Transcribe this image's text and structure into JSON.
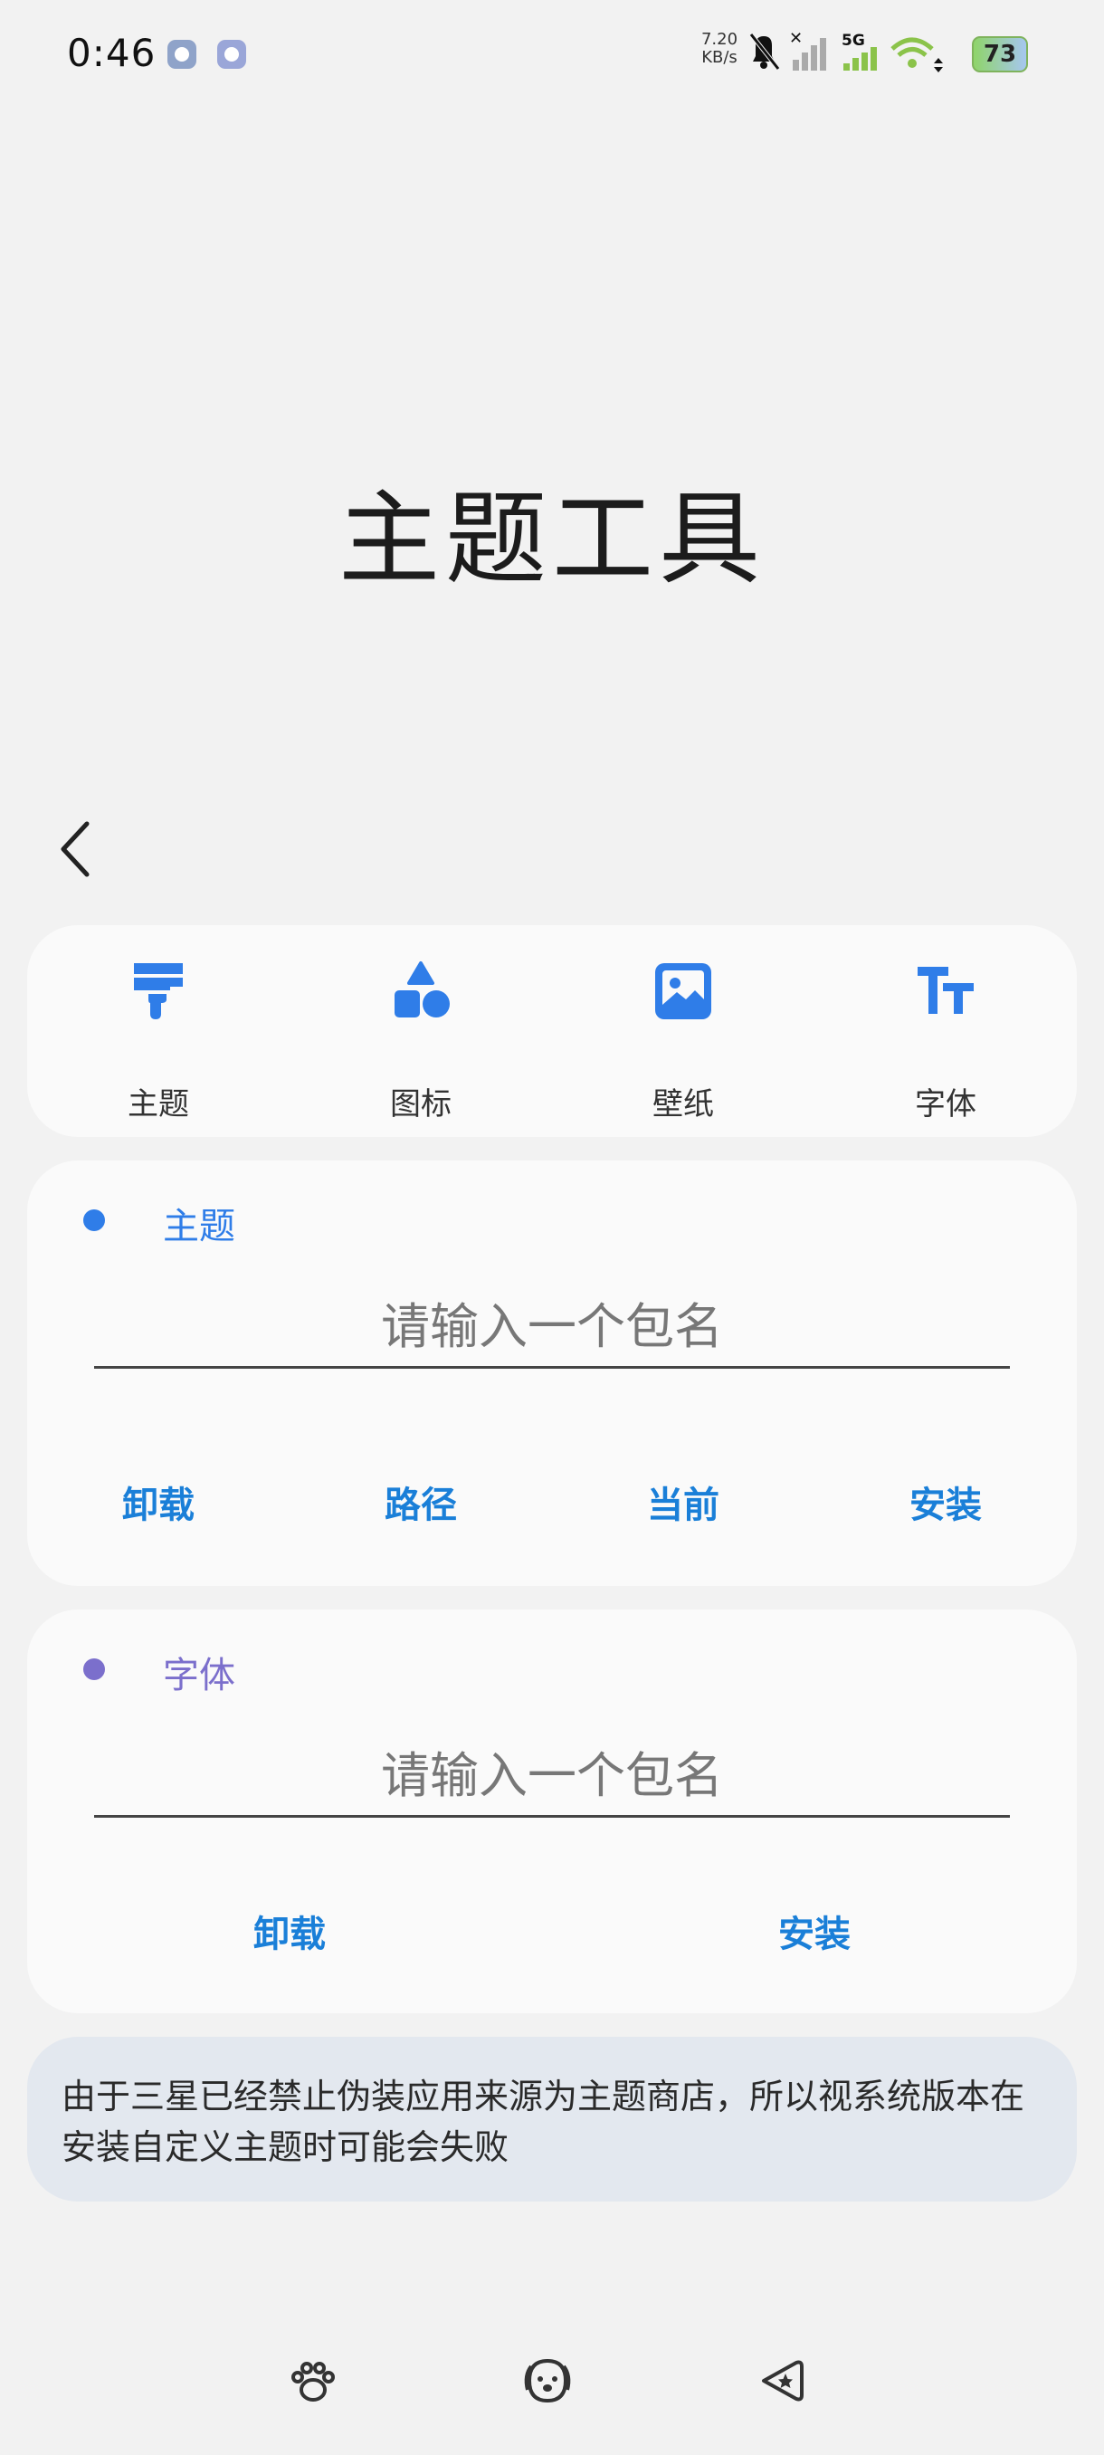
{
  "status_bar": {
    "time": "0:46",
    "net_speed_value": "7.20",
    "net_speed_unit": "KB/s",
    "network_type": "5G",
    "battery": "73"
  },
  "page": {
    "title": "主题工具"
  },
  "tabs": [
    {
      "label": "主题",
      "icon": "brush-icon"
    },
    {
      "label": "图标",
      "icon": "shapes-icon"
    },
    {
      "label": "壁纸",
      "icon": "image-icon"
    },
    {
      "label": "字体",
      "icon": "font-icon"
    }
  ],
  "theme_section": {
    "title": "主题",
    "dot_color": "#2f7de8",
    "input_placeholder": "请输入一个包名",
    "actions": [
      "卸载",
      "路径",
      "当前",
      "安装"
    ]
  },
  "font_section": {
    "title": "字体",
    "dot_color": "#7b6fcc",
    "input_placeholder": "请输入一个包名",
    "actions": [
      "卸载",
      "安装"
    ]
  },
  "notice": {
    "text": "由于三星已经禁止伪装应用来源为主题商店，所以视系统版本在安装自定义主题时可能会失败"
  },
  "colors": {
    "accent": "#2f7de8",
    "action_text": "#1a7fd8",
    "font_accent": "#7b6fcc"
  }
}
